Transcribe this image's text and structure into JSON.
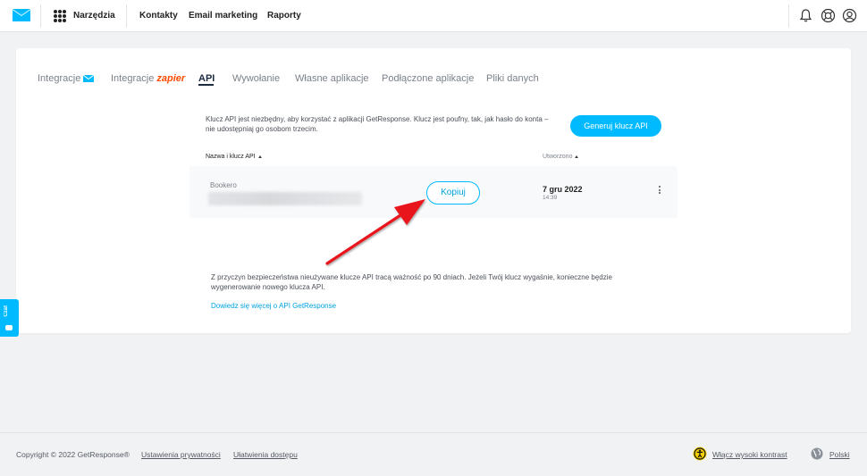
{
  "topbar": {
    "tools_label": "Narzędzia",
    "nav": [
      "Kontakty",
      "Email marketing",
      "Raporty"
    ],
    "icons": [
      "bell-icon",
      "help-lifebuoy-icon",
      "user-account-icon"
    ]
  },
  "tabs": [
    {
      "label": "Integracje",
      "active": false,
      "extra_icon": "envelope-icon"
    },
    {
      "label": "Integracje",
      "active": false,
      "extra_text": "zapier"
    },
    {
      "label": "API",
      "active": true
    },
    {
      "label": "Wywołanie",
      "active": false
    },
    {
      "label": "Własne aplikacje",
      "active": false
    },
    {
      "label": "Podłączone aplikacje",
      "active": false
    },
    {
      "label": "Pliki danych",
      "active": false
    }
  ],
  "api": {
    "info": "Klucz API jest niezbędny, aby korzystać z aplikacji GetResponse. Klucz jest poufny, tak, jak hasło do konta – nie udostępniaj go osobom trzecim.",
    "generate_button": "Generuj klucz API",
    "table": {
      "col_name": "Nazwa i klucz API",
      "col_created": "Utworzono",
      "rows": [
        {
          "name": "Bookero",
          "copy_label": "Kopiuj",
          "date": "7 gru 2022",
          "time": "14:39"
        }
      ]
    },
    "note": "Z przyczyn bezpieczeństwa nieużywane klucze API tracą ważność po 90 dniach. Jeżeli Twój klucz wygaśnie, konieczne będzie wygenerowanie nowego klucza API.",
    "more_link": "Dowiedz się więcej o API GetResponse"
  },
  "chat": {
    "label": "Czat"
  },
  "footer": {
    "copyright": "Copyright © 2022 GetResponse®",
    "privacy": "Ustawienia prywatności",
    "accessibility": "Ułatwienia dostępu",
    "contrast": "Włącz wysoki kontrast",
    "language": "Polski"
  },
  "colors": {
    "accent": "#00baff",
    "annotation_arrow": "#e8141b",
    "zapier": "#ff4a00"
  }
}
